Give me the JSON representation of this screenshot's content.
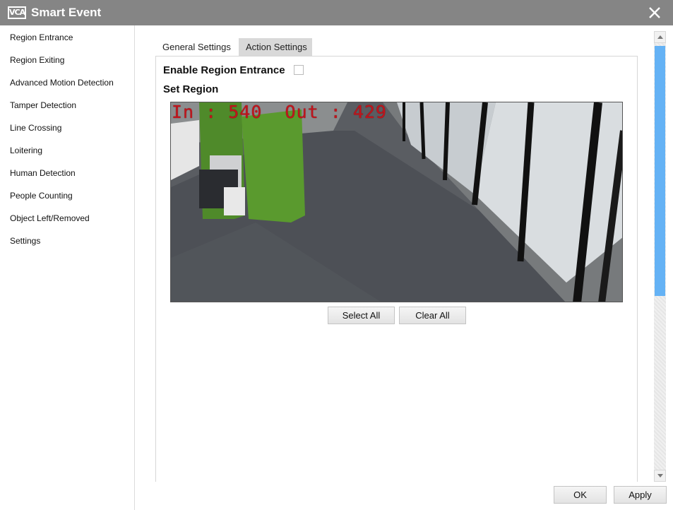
{
  "window": {
    "logo_text": "VCA",
    "title": "Smart Event"
  },
  "sidebar": {
    "items": [
      {
        "label": "Region Entrance"
      },
      {
        "label": "Region Exiting"
      },
      {
        "label": "Advanced Motion Detection"
      },
      {
        "label": "Tamper Detection"
      },
      {
        "label": "Line Crossing"
      },
      {
        "label": "Loitering"
      },
      {
        "label": "Human Detection"
      },
      {
        "label": "People Counting"
      },
      {
        "label": "Object Left/Removed"
      },
      {
        "label": "Settings"
      }
    ]
  },
  "tabs": [
    {
      "label": "General Settings",
      "active": true
    },
    {
      "label": "Action Settings",
      "active": false
    }
  ],
  "form": {
    "enable_label": "Enable Region Entrance",
    "enable_checked": false,
    "set_region_label": "Set Region"
  },
  "video": {
    "overlay_text": "In : 540  Out : 429",
    "in_count": 540,
    "out_count": 429
  },
  "buttons": {
    "select_all": "Select All",
    "clear_all": "Clear All",
    "ok": "OK",
    "apply": "Apply"
  },
  "colors": {
    "titlebar": "#858585",
    "scroll_thumb": "#64b2f5",
    "counter_text": "#c0141c"
  },
  "icons": {
    "close": "close-icon",
    "scroll_up": "scroll-up-arrow-icon",
    "scroll_down": "scroll-down-arrow-icon"
  }
}
